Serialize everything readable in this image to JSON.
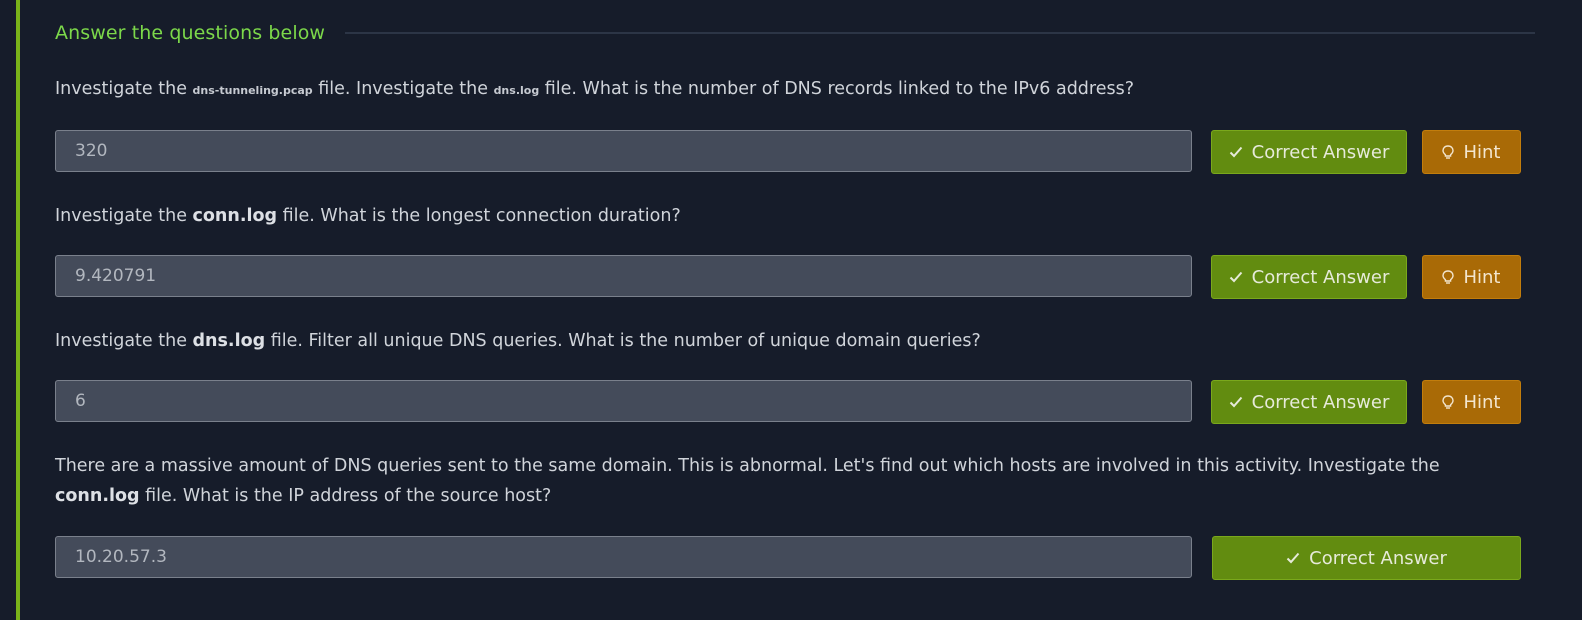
{
  "section": {
    "title": "Answer the questions below"
  },
  "questions": [
    {
      "segments": [
        "Investigate the ",
        "dns-tunneling.pcap",
        " file. Investigate the ",
        "dns.log",
        " file. What is the number of DNS records linked to the IPv6 address?"
      ],
      "answer": "320",
      "correct_label": "Correct Answer",
      "hint_label": "Hint"
    },
    {
      "segments": [
        "Investigate the ",
        "conn.log",
        " file. What is the longest connection duration?"
      ],
      "answer": "9.420791",
      "correct_label": "Correct Answer",
      "hint_label": "Hint"
    },
    {
      "segments": [
        "Investigate the ",
        "dns.log",
        " file. Filter all unique DNS queries. What is the number of unique domain queries?"
      ],
      "answer": "6",
      "correct_label": "Correct Answer",
      "hint_label": "Hint"
    },
    {
      "segments": [
        "There are a massive amount of DNS queries sent to the same domain. This is abnormal. Let's find out which hosts are involved in this activity. Investigate the ",
        "conn.log",
        " file. What is the IP address of the source host?"
      ],
      "answer": "10.20.57.3",
      "correct_label": "Correct Answer"
    }
  ],
  "colors": {
    "accent_green": "#7cd84a",
    "correct_button": "#628c10",
    "hint_button": "#a96a06",
    "left_border": "#7ab31a"
  },
  "icons": {
    "correct": "check-icon",
    "hint": "lightbulb-icon"
  }
}
